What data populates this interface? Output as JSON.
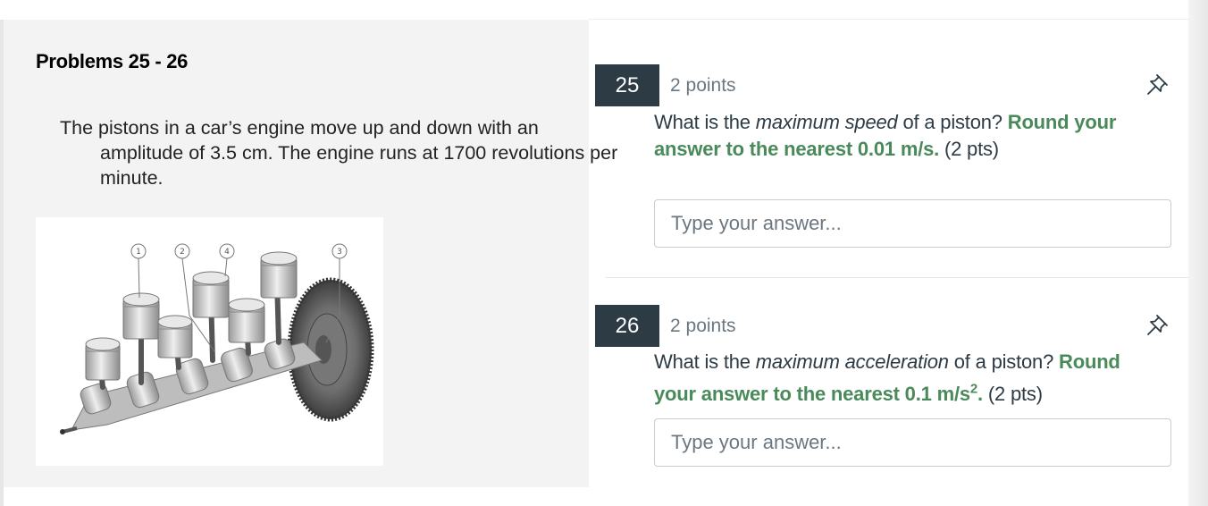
{
  "passage": {
    "title": "Problems 25 - 26",
    "text": "The pistons in a car’s engine move up and down with an amplitude of 3.5 cm. The engine runs at 1700 revolutions per minute.",
    "figure": {
      "callouts": [
        "1",
        "2",
        "4",
        "3"
      ]
    }
  },
  "questions": [
    {
      "number": "25",
      "points": "2 points",
      "text_prefix": "What is the ",
      "text_em": "maximum speed",
      "text_mid": " of a piston? ",
      "hint": "Round your answer to the nearest 0.01 m/s.",
      "pts": " (2 pts)",
      "placeholder": "Type your answer...",
      "icon": "pin-icon"
    },
    {
      "number": "26",
      "points": "2 points",
      "text_prefix": "What is the ",
      "text_em": "maximum acceleration",
      "text_mid": " of a piston? ",
      "hint_before_sup": "Round your answer to the nearest 0.1 m/s",
      "hint_sup": "2",
      "hint_after_sup": ".",
      "pts": " (2 pts)",
      "placeholder": "Type your answer...",
      "icon": "pin-icon"
    }
  ]
}
